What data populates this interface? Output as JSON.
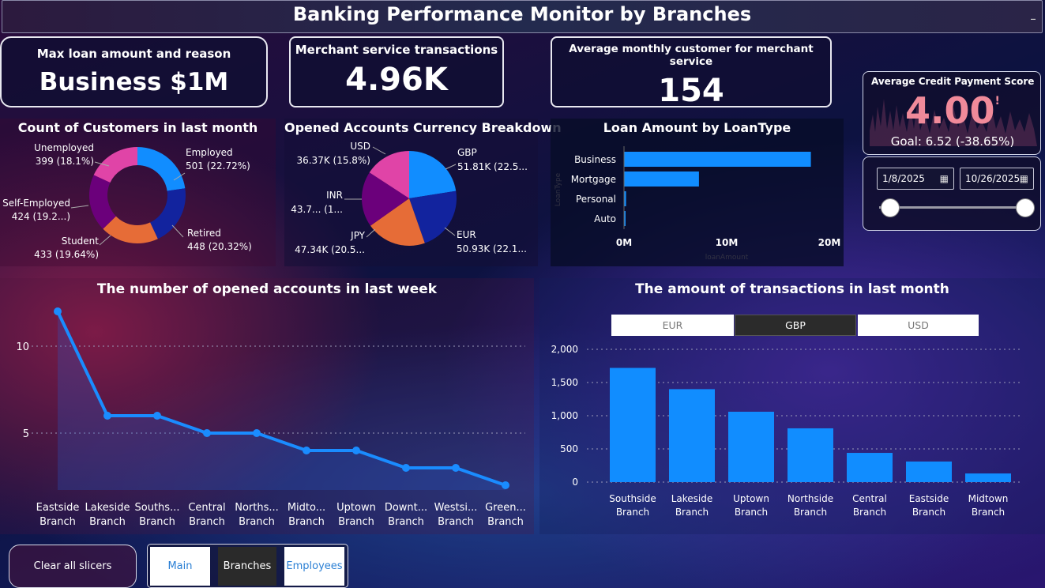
{
  "header": {
    "title": "Banking Performance Monitor by Branches",
    "minimize_glyph": "_"
  },
  "kpis": {
    "max_loan": {
      "label": "Max loan amount and reason",
      "value": "Business $1M"
    },
    "merchant_tx": {
      "label": "Merchant service transactions",
      "value": "4.96K"
    },
    "avg_monthly": {
      "label": "Average monthly customer for merchant service",
      "value": "154"
    }
  },
  "gauge": {
    "label": "Average Credit Payment Score",
    "value": "4.00",
    "marker": "!",
    "goal": "Goal: 6.52 (-38.65%)"
  },
  "date_slicer": {
    "start": "1/8/2025",
    "end": "10/26/2025",
    "calendar_icon": "calendar-icon"
  },
  "customers": {
    "title": "Count of Customers in last month",
    "slices": [
      {
        "name": "Employed",
        "label": "501 (22.72%)",
        "value": 501,
        "color": "#118dff"
      },
      {
        "name": "Retired",
        "label": "448 (20.32%)",
        "value": 448,
        "color": "#12239e"
      },
      {
        "name": "Student",
        "label": "433 (19.64%)",
        "value": 433,
        "color": "#e66c37"
      },
      {
        "name": "Self-Employed",
        "label": "424 (19.2...)",
        "value": 424,
        "color": "#6b007b"
      },
      {
        "name": "Unemployed",
        "label": "399 (18.1%)",
        "value": 399,
        "color": "#e044a7"
      }
    ]
  },
  "currency": {
    "title": "Opened Accounts Currency Breakdown",
    "slices": [
      {
        "name": "GBP",
        "label": "51.81K (22.5...",
        "value": 51.81,
        "color": "#118dff"
      },
      {
        "name": "EUR",
        "label": "50.93K (22.1...",
        "value": 50.93,
        "color": "#12239e"
      },
      {
        "name": "JPY",
        "label": "47.34K (20.5...",
        "value": 47.34,
        "color": "#e66c37"
      },
      {
        "name": "INR",
        "label": "43.7... (1...",
        "value": 43.7,
        "color": "#6b007b"
      },
      {
        "name": "USD",
        "label": "36.37K (15.8%)",
        "value": 36.37,
        "color": "#e044a7"
      }
    ]
  },
  "loan_by_type": {
    "title": "Loan Amount by LoanType",
    "ylabel": "LoanType",
    "xlabel": "loanAmount",
    "ticks": [
      "0M",
      "10M",
      "20M"
    ]
  },
  "opened_accounts": {
    "title": "The number of opened accounts in last week",
    "ticks": [
      "10",
      "5"
    ]
  },
  "transactions": {
    "title": "The amount of transactions in last month",
    "currency_tabs": [
      "EUR",
      "GBP",
      "USD"
    ],
    "selected_currency": "GBP",
    "ticks": [
      "2,000",
      "1,500",
      "1,000",
      "500",
      "0"
    ]
  },
  "footer": {
    "clear_label": "Clear all slicers",
    "nav": [
      "Main",
      "Branches",
      "Employees"
    ],
    "active_nav": "Branches"
  },
  "chart_data": [
    {
      "type": "pie",
      "title": "Count of Customers in last month",
      "categories": [
        "Employed",
        "Retired",
        "Student",
        "Self-Employed",
        "Unemployed"
      ],
      "values": [
        501,
        448,
        433,
        424,
        399
      ]
    },
    {
      "type": "pie",
      "title": "Opened Accounts Currency Breakdown",
      "categories": [
        "GBP",
        "EUR",
        "JPY",
        "INR",
        "USD"
      ],
      "values": [
        51810,
        50930,
        47340,
        43700,
        36370
      ]
    },
    {
      "type": "bar",
      "title": "Loan Amount by LoanType",
      "orientation": "horizontal",
      "categories": [
        "Business",
        "Mortgage",
        "Personal",
        "Auto"
      ],
      "values": [
        18200000,
        7300000,
        200000,
        150000
      ],
      "xlabel": "loanAmount",
      "ylabel": "LoanType",
      "xlim": [
        0,
        20000000
      ]
    },
    {
      "type": "area",
      "title": "The number of opened accounts in last week",
      "categories": [
        "Eastside Branch",
        "Lakeside Branch",
        "Souths... Branch",
        "Central Branch",
        "Norths... Branch",
        "Midto... Branch",
        "Uptown Branch",
        "Downt... Branch",
        "Westsi... Branch",
        "Green... Branch"
      ],
      "values": [
        12,
        6,
        6,
        5,
        5,
        4,
        4,
        3,
        3,
        2
      ],
      "ylim": [
        2,
        12.5
      ]
    },
    {
      "type": "bar",
      "title": "The amount of transactions in last month",
      "categories": [
        "Southside Branch",
        "Lakeside Branch",
        "Uptown Branch",
        "Northside Branch",
        "Central Branch",
        "Eastside Branch",
        "Midtown Branch"
      ],
      "values": [
        1720,
        1400,
        1060,
        810,
        440,
        310,
        130
      ],
      "ylim": [
        0,
        2000
      ]
    }
  ]
}
